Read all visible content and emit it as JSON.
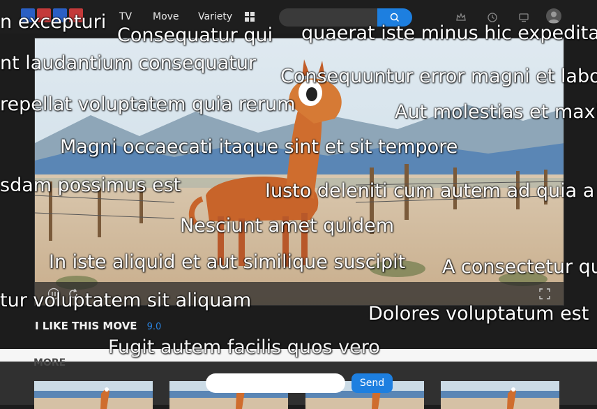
{
  "nav": {
    "links": [
      "TV",
      "Move",
      "Variety"
    ],
    "search_placeholder": ""
  },
  "send_label": "Send",
  "movie": {
    "title": "I LIKE THIS MOVE",
    "rating": "9.0"
  },
  "more_label": "MORE",
  "danmaku": [
    "n excepturi",
    "Consequatur qui",
    "quaerat iste minus hic expedita",
    "nt laudantium consequatur",
    "Consequuntur error magni et labo",
    "repellat voluptatem quia rerum",
    "Aut molestias et maxi",
    "Magni occaecati itaque sint et sit tempore",
    "sdam possimus est",
    "Iusto deleniti cum autem ad quia a",
    "Nesciunt amet quidem",
    "In iste aliquid et aut similique suscipit",
    "A consectetur qu",
    "tur voluptatem sit aliquam",
    "Dolores voluptatum est",
    "Fugit autem facilis quos vero"
  ],
  "colors": {
    "accent": "#1d7fe0",
    "rating": "#2a83e0"
  }
}
